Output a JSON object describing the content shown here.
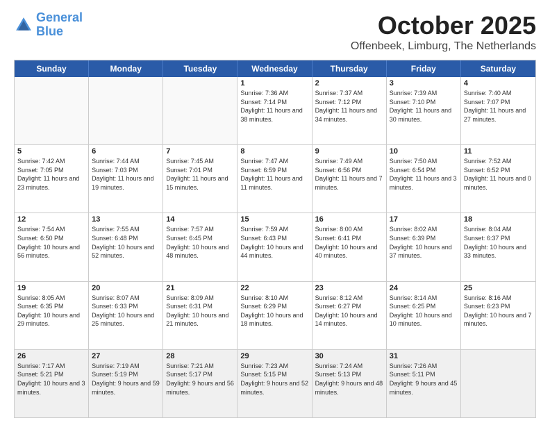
{
  "header": {
    "logo_line1": "General",
    "logo_line2": "Blue",
    "month": "October 2025",
    "location": "Offenbeek, Limburg, The Netherlands"
  },
  "weekdays": [
    "Sunday",
    "Monday",
    "Tuesday",
    "Wednesday",
    "Thursday",
    "Friday",
    "Saturday"
  ],
  "rows": [
    [
      {
        "day": "",
        "info": ""
      },
      {
        "day": "",
        "info": ""
      },
      {
        "day": "",
        "info": ""
      },
      {
        "day": "1",
        "info": "Sunrise: 7:36 AM\nSunset: 7:14 PM\nDaylight: 11 hours\nand 38 minutes."
      },
      {
        "day": "2",
        "info": "Sunrise: 7:37 AM\nSunset: 7:12 PM\nDaylight: 11 hours\nand 34 minutes."
      },
      {
        "day": "3",
        "info": "Sunrise: 7:39 AM\nSunset: 7:10 PM\nDaylight: 11 hours\nand 30 minutes."
      },
      {
        "day": "4",
        "info": "Sunrise: 7:40 AM\nSunset: 7:07 PM\nDaylight: 11 hours\nand 27 minutes."
      }
    ],
    [
      {
        "day": "5",
        "info": "Sunrise: 7:42 AM\nSunset: 7:05 PM\nDaylight: 11 hours\nand 23 minutes."
      },
      {
        "day": "6",
        "info": "Sunrise: 7:44 AM\nSunset: 7:03 PM\nDaylight: 11 hours\nand 19 minutes."
      },
      {
        "day": "7",
        "info": "Sunrise: 7:45 AM\nSunset: 7:01 PM\nDaylight: 11 hours\nand 15 minutes."
      },
      {
        "day": "8",
        "info": "Sunrise: 7:47 AM\nSunset: 6:59 PM\nDaylight: 11 hours\nand 11 minutes."
      },
      {
        "day": "9",
        "info": "Sunrise: 7:49 AM\nSunset: 6:56 PM\nDaylight: 11 hours\nand 7 minutes."
      },
      {
        "day": "10",
        "info": "Sunrise: 7:50 AM\nSunset: 6:54 PM\nDaylight: 11 hours\nand 3 minutes."
      },
      {
        "day": "11",
        "info": "Sunrise: 7:52 AM\nSunset: 6:52 PM\nDaylight: 11 hours\nand 0 minutes."
      }
    ],
    [
      {
        "day": "12",
        "info": "Sunrise: 7:54 AM\nSunset: 6:50 PM\nDaylight: 10 hours\nand 56 minutes."
      },
      {
        "day": "13",
        "info": "Sunrise: 7:55 AM\nSunset: 6:48 PM\nDaylight: 10 hours\nand 52 minutes."
      },
      {
        "day": "14",
        "info": "Sunrise: 7:57 AM\nSunset: 6:45 PM\nDaylight: 10 hours\nand 48 minutes."
      },
      {
        "day": "15",
        "info": "Sunrise: 7:59 AM\nSunset: 6:43 PM\nDaylight: 10 hours\nand 44 minutes."
      },
      {
        "day": "16",
        "info": "Sunrise: 8:00 AM\nSunset: 6:41 PM\nDaylight: 10 hours\nand 40 minutes."
      },
      {
        "day": "17",
        "info": "Sunrise: 8:02 AM\nSunset: 6:39 PM\nDaylight: 10 hours\nand 37 minutes."
      },
      {
        "day": "18",
        "info": "Sunrise: 8:04 AM\nSunset: 6:37 PM\nDaylight: 10 hours\nand 33 minutes."
      }
    ],
    [
      {
        "day": "19",
        "info": "Sunrise: 8:05 AM\nSunset: 6:35 PM\nDaylight: 10 hours\nand 29 minutes."
      },
      {
        "day": "20",
        "info": "Sunrise: 8:07 AM\nSunset: 6:33 PM\nDaylight: 10 hours\nand 25 minutes."
      },
      {
        "day": "21",
        "info": "Sunrise: 8:09 AM\nSunset: 6:31 PM\nDaylight: 10 hours\nand 21 minutes."
      },
      {
        "day": "22",
        "info": "Sunrise: 8:10 AM\nSunset: 6:29 PM\nDaylight: 10 hours\nand 18 minutes."
      },
      {
        "day": "23",
        "info": "Sunrise: 8:12 AM\nSunset: 6:27 PM\nDaylight: 10 hours\nand 14 minutes."
      },
      {
        "day": "24",
        "info": "Sunrise: 8:14 AM\nSunset: 6:25 PM\nDaylight: 10 hours\nand 10 minutes."
      },
      {
        "day": "25",
        "info": "Sunrise: 8:16 AM\nSunset: 6:23 PM\nDaylight: 10 hours\nand 7 minutes."
      }
    ],
    [
      {
        "day": "26",
        "info": "Sunrise: 7:17 AM\nSunset: 5:21 PM\nDaylight: 10 hours\nand 3 minutes."
      },
      {
        "day": "27",
        "info": "Sunrise: 7:19 AM\nSunset: 5:19 PM\nDaylight: 9 hours\nand 59 minutes."
      },
      {
        "day": "28",
        "info": "Sunrise: 7:21 AM\nSunset: 5:17 PM\nDaylight: 9 hours\nand 56 minutes."
      },
      {
        "day": "29",
        "info": "Sunrise: 7:23 AM\nSunset: 5:15 PM\nDaylight: 9 hours\nand 52 minutes."
      },
      {
        "day": "30",
        "info": "Sunrise: 7:24 AM\nSunset: 5:13 PM\nDaylight: 9 hours\nand 48 minutes."
      },
      {
        "day": "31",
        "info": "Sunrise: 7:26 AM\nSunset: 5:11 PM\nDaylight: 9 hours\nand 45 minutes."
      },
      {
        "day": "",
        "info": ""
      }
    ]
  ]
}
